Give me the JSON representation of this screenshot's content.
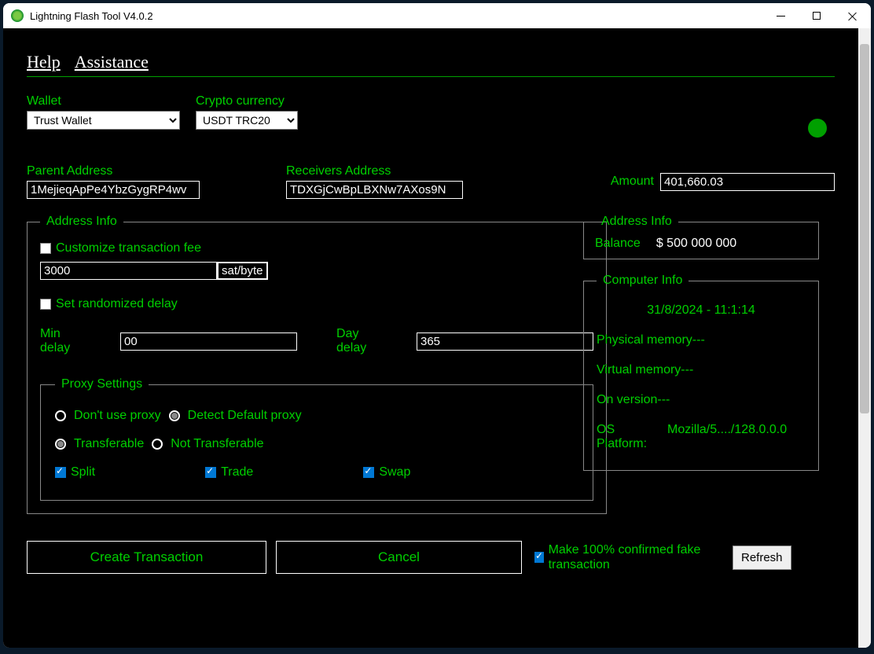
{
  "title": "Lightning Flash Tool V4.0.2",
  "menu": {
    "help": "Help",
    "assist": "Assistance"
  },
  "wallet": {
    "label": "Wallet",
    "value": "Trust Wallet"
  },
  "crypto": {
    "label": "Crypto currency",
    "value": "USDT TRC20"
  },
  "parent": {
    "label": "Parent Address",
    "value": "1MejieqApPe4YbzGygRP4wv"
  },
  "receiver": {
    "label": "Receivers Address",
    "value": "TDXGjCwBpLBXNw7AXos9N"
  },
  "amount": {
    "label": "Amount",
    "value": "401,660.03"
  },
  "addrInfo": {
    "legend": "Address Info",
    "customizeFee": "Customize transaction fee",
    "feeValue": "3000",
    "satByte": "sat/byte",
    "setRandom": "Set randomized delay",
    "minDelayLbl": "Min delay",
    "minDelayVal": "00",
    "dayDelayLbl": "Day delay",
    "dayDelayVal": "365"
  },
  "proxy": {
    "legend": "Proxy Settings",
    "dontUse": "Don't use proxy",
    "detect": "Detect Default proxy",
    "transferable": "Transferable",
    "notTransferable": "Not Transferable",
    "split": "Split",
    "trade": "Trade",
    "swap": "Swap"
  },
  "rightInfo": {
    "legend": "Address Info",
    "balanceLbl": "Balance",
    "balanceVal": "$ 500 000 000"
  },
  "computer": {
    "legend": "Computer Info",
    "date": "31/8/2024 - 11:1:14",
    "phys": "Physical memory---",
    "virt": "Virtual memory---",
    "ver": "On version---",
    "osLbl": "OS Platform:",
    "osVal": "Mozilla/5..../128.0.0.0"
  },
  "buttons": {
    "create": "Create Transaction",
    "cancel": "Cancel",
    "confirm": "Make 100% confirmed fake transaction",
    "refresh": "Refresh"
  }
}
